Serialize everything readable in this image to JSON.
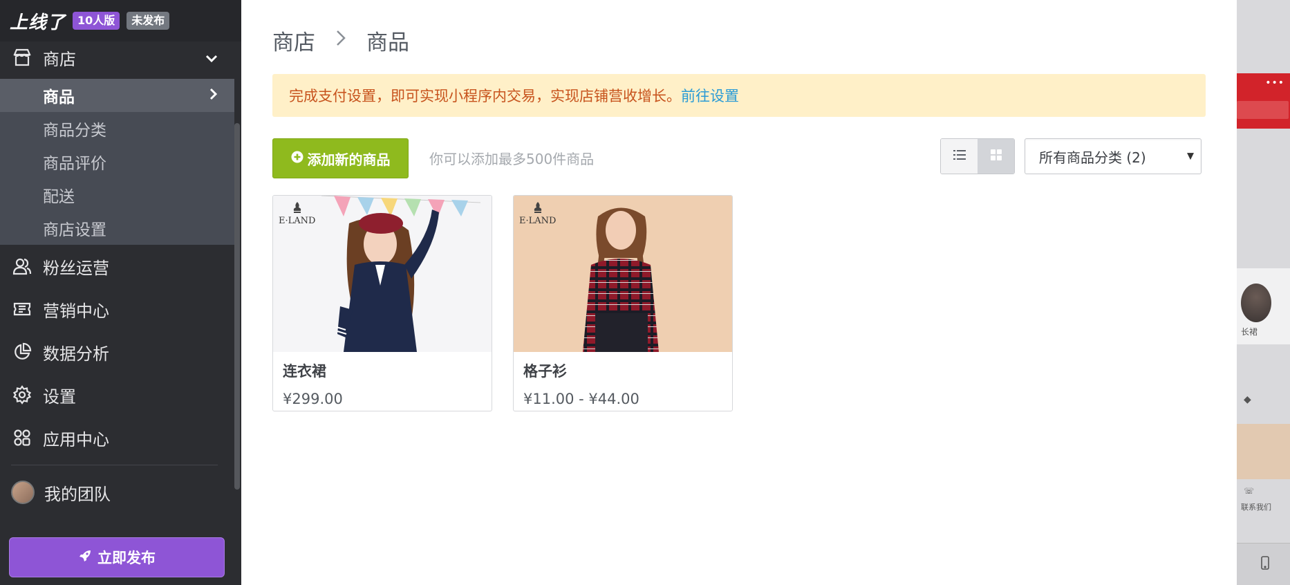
{
  "brand": {
    "logo": "上线了",
    "plan_badge": "10人版",
    "status_badge": "未发布"
  },
  "sidebar": {
    "shop": {
      "label": "商店",
      "icon": "shop-icon",
      "expanded": true,
      "children": [
        {
          "label": "商品",
          "active": true
        },
        {
          "label": "商品分类"
        },
        {
          "label": "商品评价"
        },
        {
          "label": "配送"
        },
        {
          "label": "商店设置"
        }
      ]
    },
    "items": [
      {
        "label": "粉丝运营",
        "icon": "fans-icon"
      },
      {
        "label": "营销中心",
        "icon": "ticket-icon"
      },
      {
        "label": "数据分析",
        "icon": "pie-chart-icon"
      },
      {
        "label": "设置",
        "icon": "gear-icon"
      },
      {
        "label": "应用中心",
        "icon": "apps-icon"
      }
    ],
    "team": {
      "label": "我的团队",
      "icon": "avatar"
    },
    "publish_label": "立即发布"
  },
  "main": {
    "breadcrumb": [
      "商店",
      "商品"
    ],
    "alert": {
      "text": "完成支付设置，即可实现小程序内交易，实现店铺营收增长。",
      "link": "前往设置"
    },
    "add_button": "添加新的商品",
    "hint": "你可以添加最多500件商品",
    "view_mode": "grid",
    "category_filter": "所有商品分类 (2)",
    "products": [
      {
        "name": "连衣裙",
        "price": "¥299.00",
        "brand_tag": "E·LAND"
      },
      {
        "name": "格子衫",
        "price": "¥11.00 - ¥44.00",
        "brand_tag": "E·LAND"
      }
    ]
  },
  "preview": {
    "item_label": "长裙",
    "contact_label": "联系我们"
  },
  "colors": {
    "sidebar_bg": "#2c2d31",
    "accent_purple": "#8e55d6",
    "add_green": "#8fba1e",
    "alert_bg": "#fff0c8",
    "alert_text": "#c7531d",
    "link_blue": "#2a9bd6"
  }
}
